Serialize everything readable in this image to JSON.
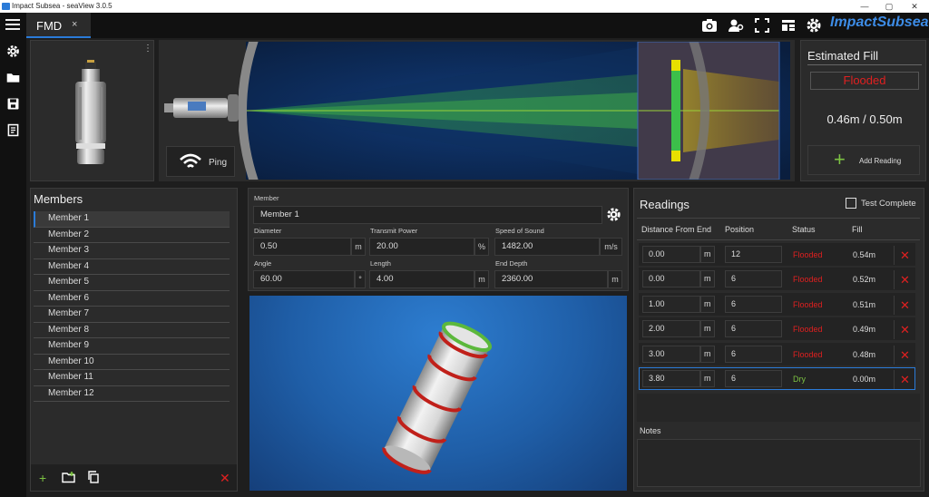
{
  "window": {
    "title": "Impact Subsea - seaView 3.0.5"
  },
  "tabs": [
    {
      "label": "FMD",
      "close": "×"
    }
  ],
  "logo_text": "ImpactSubsea",
  "sensor_menu": "⋮",
  "ping_label": "Ping",
  "estimated_fill": {
    "title": "Estimated Fill",
    "status": "Flooded",
    "value": "0.46m / 0.50m",
    "add_reading_label": "Add Reading"
  },
  "members": {
    "title": "Members",
    "items": [
      "Member 1",
      "Member 2",
      "Member 3",
      "Member 4",
      "Member 5",
      "Member 6",
      "Member 7",
      "Member 8",
      "Member 9",
      "Member 10",
      "Member 11",
      "Member 12"
    ]
  },
  "form": {
    "member_label": "Member",
    "member_value": "Member 1",
    "diameter_label": "Diameter",
    "diameter_value": "0.50",
    "diameter_unit": "m",
    "tx_power_label": "Transmit Power",
    "tx_power_value": "20.00",
    "tx_power_unit": "%",
    "sos_label": "Speed of Sound",
    "sos_value": "1482.00",
    "sos_unit": "m/s",
    "angle_label": "Angle",
    "angle_value": "60.00",
    "angle_unit": "°",
    "length_label": "Length",
    "length_value": "4.00",
    "length_unit": "m",
    "end_depth_label": "End Depth",
    "end_depth_value": "2360.00",
    "end_depth_unit": "m"
  },
  "readings": {
    "title": "Readings",
    "test_complete_label": "Test Complete",
    "test_complete_checked": false,
    "headers": {
      "distance": "Distance From End",
      "position": "Position",
      "status": "Status",
      "fill": "Fill"
    },
    "unit": "m",
    "rows": [
      {
        "distance": "0.00",
        "position": "12",
        "status": "Flooded",
        "fill": "0.54m"
      },
      {
        "distance": "0.00",
        "position": "6",
        "status": "Flooded",
        "fill": "0.52m"
      },
      {
        "distance": "1.00",
        "position": "6",
        "status": "Flooded",
        "fill": "0.51m"
      },
      {
        "distance": "2.00",
        "position": "6",
        "status": "Flooded",
        "fill": "0.49m"
      },
      {
        "distance": "3.00",
        "position": "6",
        "status": "Flooded",
        "fill": "0.48m"
      },
      {
        "distance": "3.80",
        "position": "6",
        "status": "Dry",
        "fill": "0.00m"
      }
    ],
    "notes_label": "Notes"
  },
  "colors": {
    "accent": "#2a7bd8",
    "flooded": "#e02020",
    "dry": "#7cc242"
  }
}
